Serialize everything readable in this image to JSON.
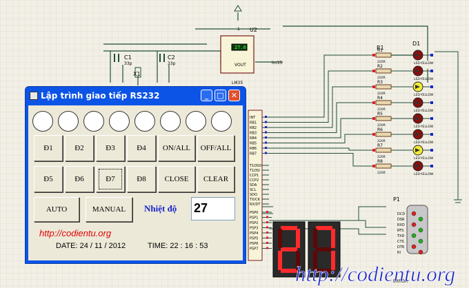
{
  "window": {
    "title": "Lập trình giao tiếp RS232",
    "led_count": 8,
    "buttons_row1": [
      "Đ1",
      "Đ2",
      "Đ3",
      "Đ4",
      "ON/ALL",
      "OFF/ALL"
    ],
    "buttons_row2": [
      "Đ5",
      "Đ6",
      "Đ7",
      "Đ8",
      "CLOSE",
      "CLEAR"
    ],
    "auto_label": "AUTO",
    "manual_label": "MANUAL",
    "temp_label": "Nhiệt độ",
    "temp_value": "27",
    "website": "http://codientu.org",
    "date_text": "DATE: 24 / 11 / 2012",
    "time_text": "TIME: 22 : 16 : 53",
    "selected_button": "Đ7"
  },
  "schematic": {
    "u2_label": "U2",
    "lm35_value": "27.0",
    "lm35_pin_label": "VOUT",
    "lm35_part": "LM35",
    "vout_net": "lm35",
    "c1_label": "C1",
    "c1_value": "33p",
    "c2_label": "C2",
    "c2_value": "33p",
    "x1_label": "X1",
    "r1_label": "R1",
    "d1_label": "D1",
    "p1_label": "P1",
    "resistor_labels": [
      "R1",
      "R2",
      "R3",
      "R4",
      "R5",
      "R6",
      "R7",
      "R8"
    ],
    "resistor_value": "220R",
    "led_part": "LED-YELLOW",
    "led_states": [
      false,
      false,
      true,
      false,
      false,
      false,
      true,
      false
    ],
    "mcu_pins_top": [
      "INT",
      "RB1",
      "RB2",
      "RB3",
      "RB4",
      "RB5",
      "RB6",
      "RB7"
    ],
    "mcu_pins_mid": [
      "T1OSO",
      "T1OSI",
      "CCP1",
      "CCP2",
      "SDA",
      "SCL",
      "SDO",
      "TX/CK",
      "RX/DT"
    ],
    "mcu_pins_bottom": [
      "PSP0",
      "PSP1",
      "PSP2",
      "PSP3",
      "PSP4",
      "PSP5",
      "PSP6",
      "PSP7"
    ],
    "port_pins": [
      "DCD",
      "DSR",
      "RXD",
      "RTS",
      "TXD",
      "CTS",
      "DTR",
      "RI"
    ],
    "port_part": "ERROR",
    "seg_display": "27",
    "watermark": "http://codientu.org"
  },
  "colors": {
    "window_blue": "#0c54e6",
    "schematic_bg": "#f2f0e6",
    "wire": "#1f4d3a",
    "led_off": "#8a1010",
    "led_on": "#f2ea3a",
    "seg_on": "#ff2a2a",
    "seg_off": "#5c0808",
    "watermark": "#1a24c8"
  }
}
